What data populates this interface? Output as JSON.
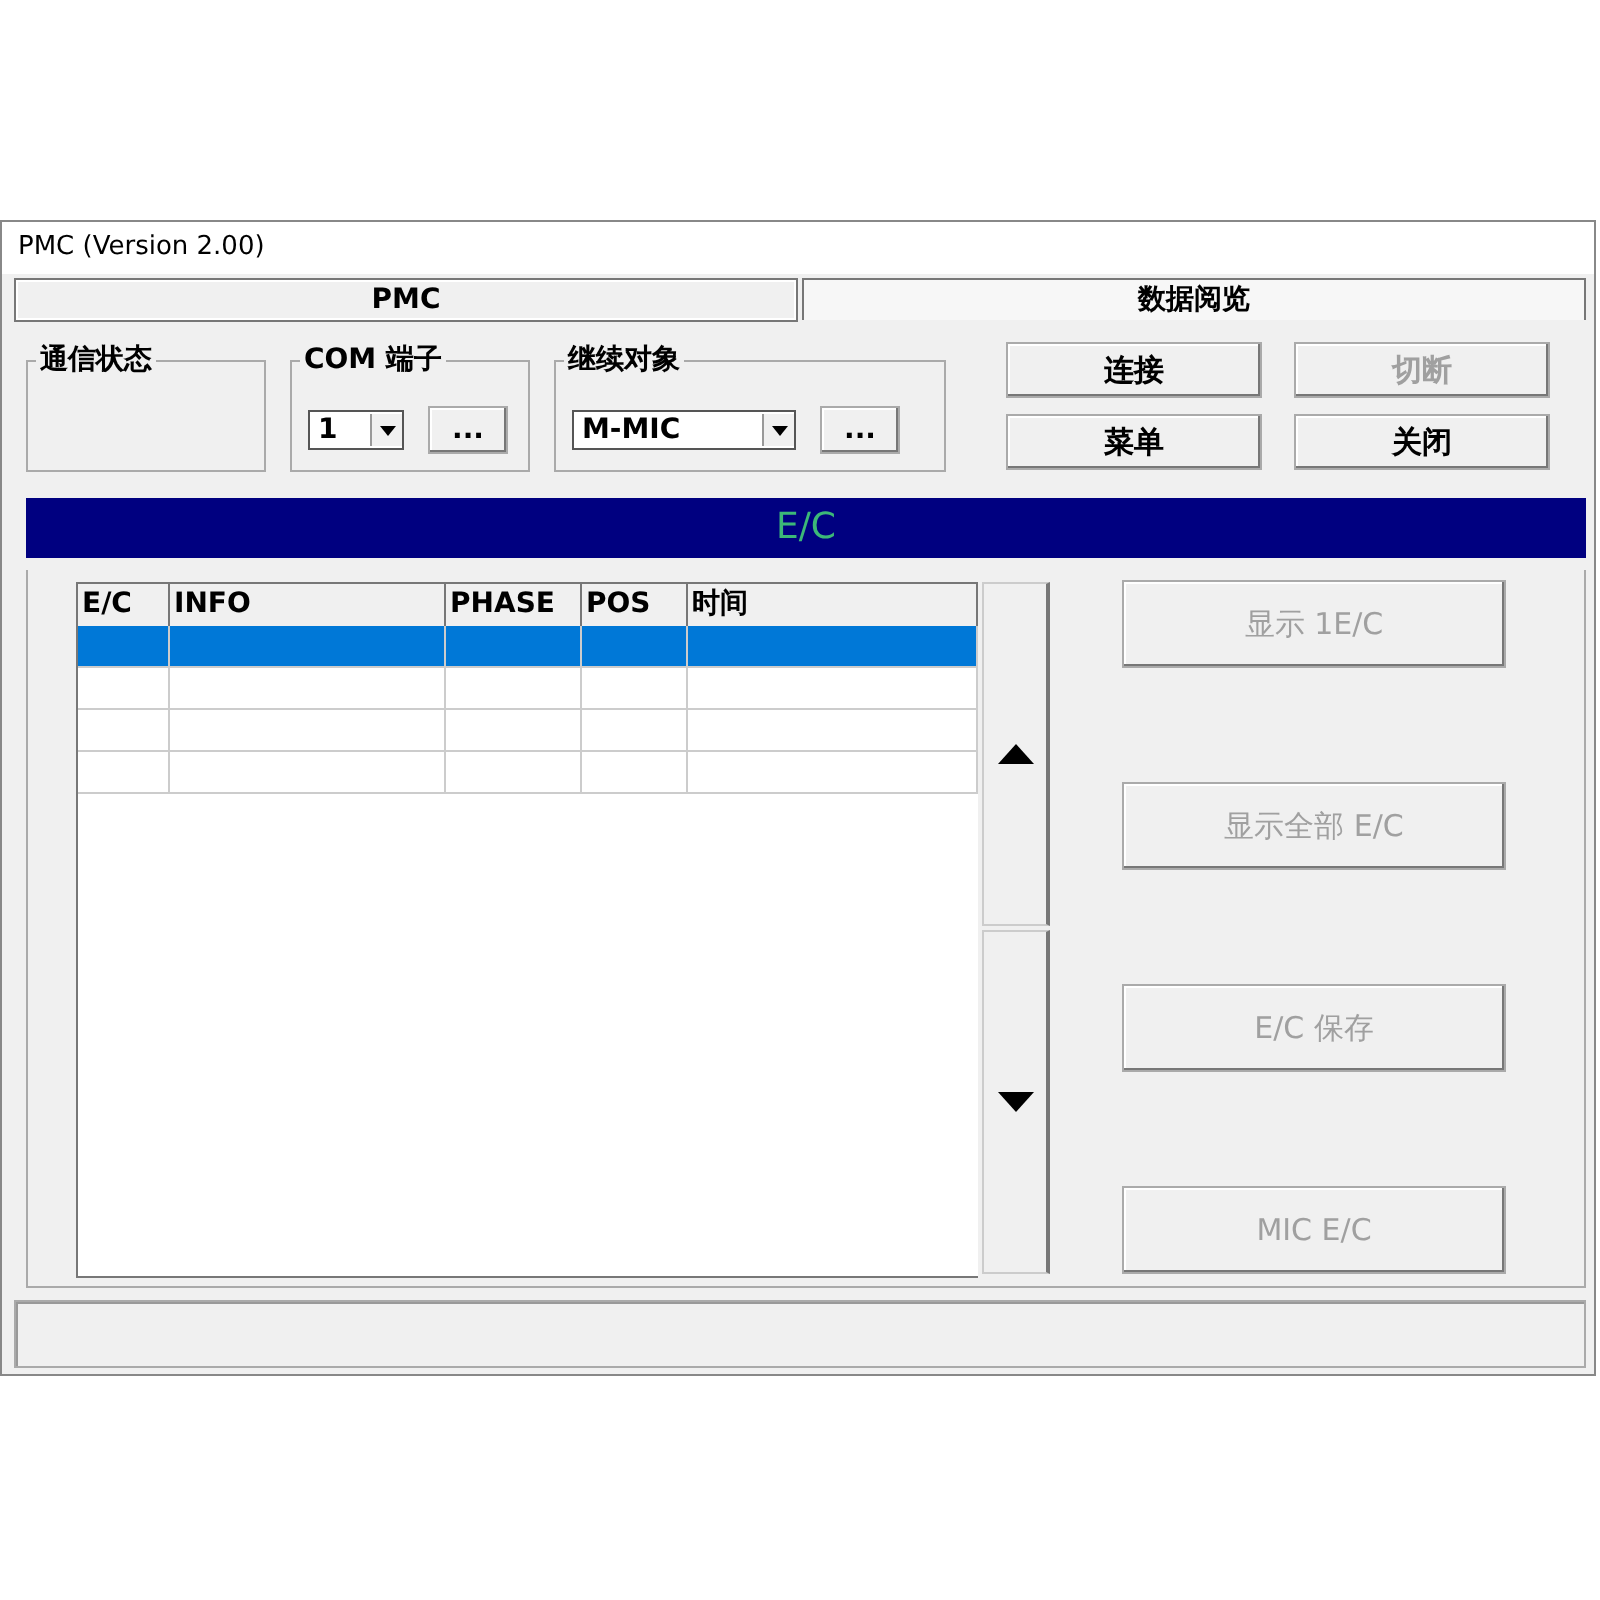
{
  "window": {
    "title": "PMC (Version 2.00)"
  },
  "tabs": [
    {
      "label": "PMC",
      "selected": true
    },
    {
      "label": "数据阅览",
      "selected": false
    }
  ],
  "status_group": {
    "label": "通信状态"
  },
  "com_group": {
    "label": "COM 端子",
    "value": "1",
    "browse": "..."
  },
  "target_group": {
    "label": "继续对象",
    "value": "M-MIC",
    "browse": "..."
  },
  "actions": [
    {
      "label": "连接",
      "disabled": false
    },
    {
      "label": "切断",
      "disabled": true
    },
    {
      "label": "菜单",
      "disabled": false
    },
    {
      "label": "关闭",
      "disabled": false
    }
  ],
  "section_title": "E/C",
  "table": {
    "columns": [
      "E/C",
      "INFO",
      "PHASE",
      "POS",
      "时间"
    ],
    "rows": [
      {
        "selected": true
      },
      {
        "selected": false
      },
      {
        "selected": false
      },
      {
        "selected": false
      }
    ]
  },
  "side_buttons": [
    {
      "label": "显示 1E/C",
      "disabled": true
    },
    {
      "label": "显示全部 E/C",
      "disabled": true
    },
    {
      "label": "E/C 保存",
      "disabled": true
    },
    {
      "label": "MIC E/C",
      "disabled": true
    }
  ]
}
